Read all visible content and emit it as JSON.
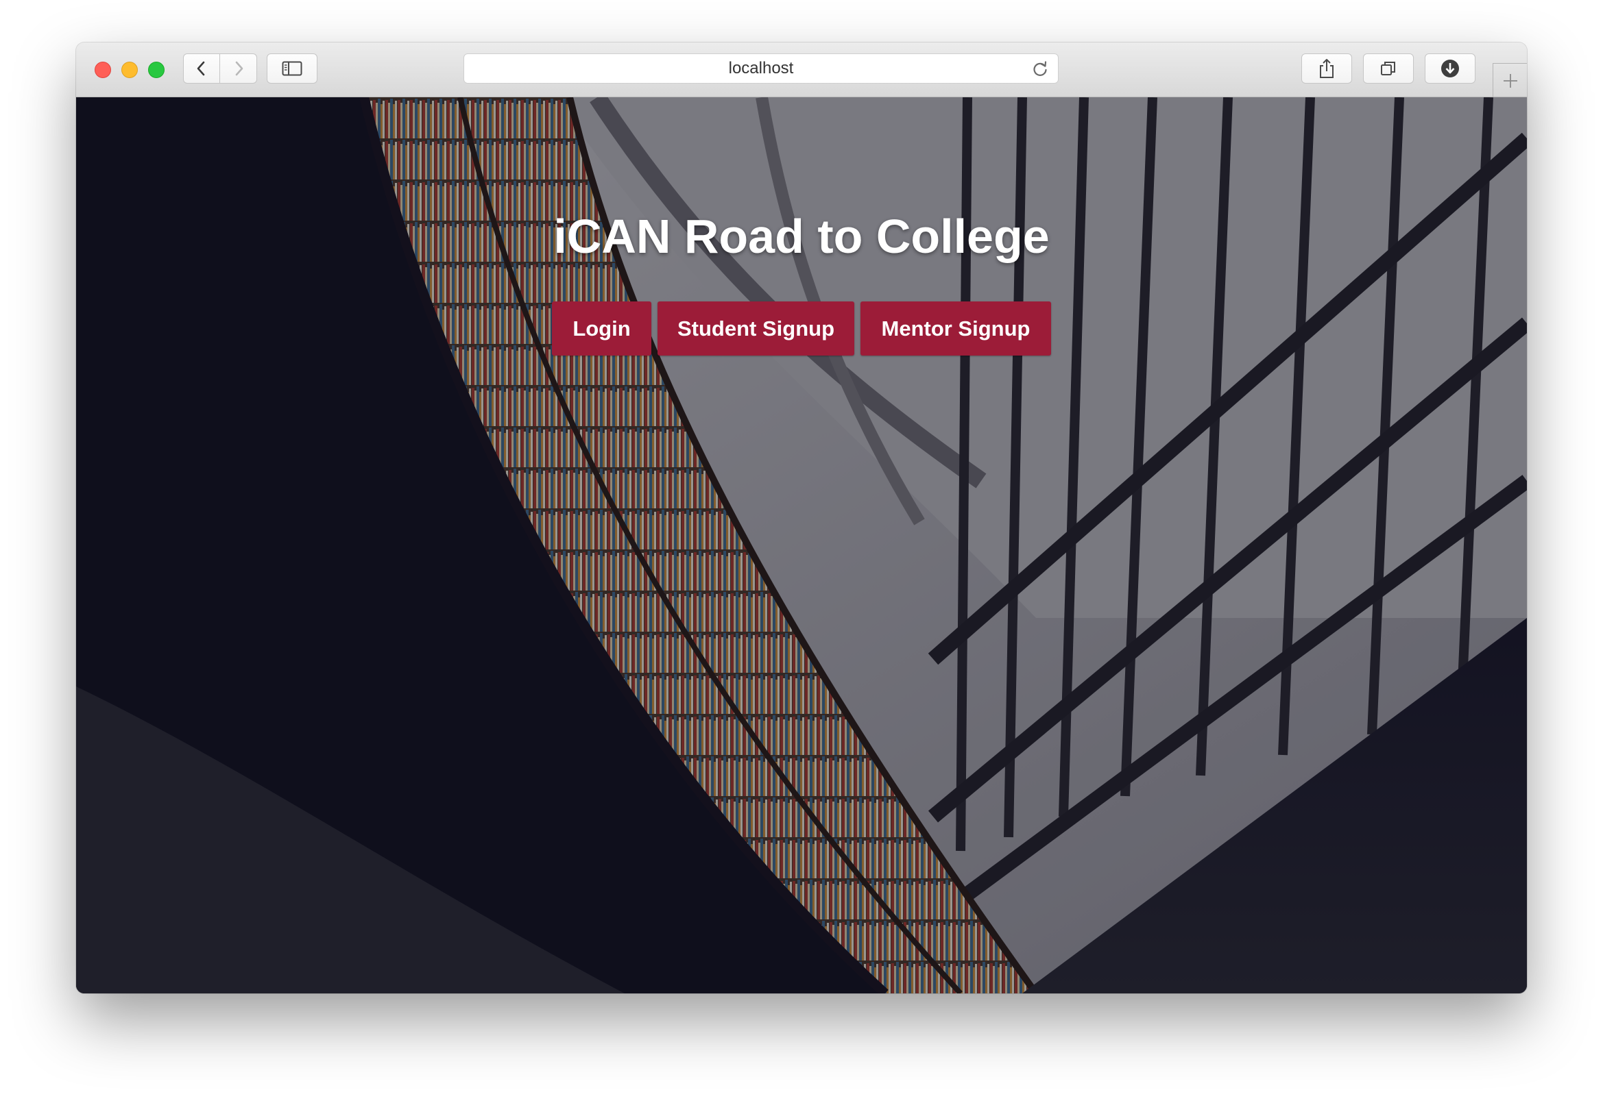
{
  "browser": {
    "url": "localhost",
    "icons": {
      "back": "chevron-left-icon",
      "forward": "chevron-right-icon",
      "sidebar": "sidebar-icon",
      "reload": "reload-icon",
      "share": "share-icon",
      "tabs": "tabs-icon",
      "downloads": "download-icon",
      "new_tab": "plus-icon"
    }
  },
  "hero": {
    "title": "iCAN Road to College",
    "buttons": {
      "login": "Login",
      "student_signup": "Student Signup",
      "mentor_signup": "Mentor Signup"
    }
  },
  "colors": {
    "button_bg": "#9c1c38",
    "button_text": "#ffffff",
    "title_text": "#ffffff"
  }
}
